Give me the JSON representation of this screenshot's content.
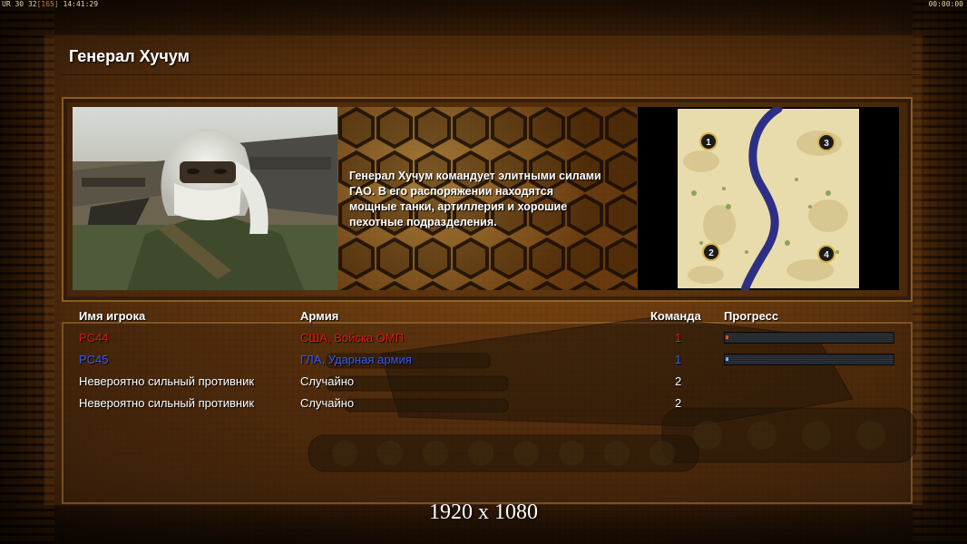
{
  "hud": {
    "left_a": "UR",
    "left_b": "30",
    "left_c": "32",
    "left_d": "[165]",
    "left_time": "14:41:29",
    "right_time": "00:00:00"
  },
  "title": "Генерал Хучум",
  "description": [
    "Генерал Хучум командует элитными силами",
    " ГАО. В его распоряжении находятся",
    " мощные танки, артиллерия и хорошие",
    " пехотные подразделения."
  ],
  "minimap": {
    "spawns": [
      "1",
      "2",
      "3",
      "4"
    ]
  },
  "table": {
    "headers": {
      "player": "Имя игрока",
      "army": "Армия",
      "team": "Команда",
      "progress": "Прогресс"
    },
    "rows": [
      {
        "player": "PC44",
        "army": "США, Войска ОМП",
        "team": "1",
        "color": "#e01a12",
        "progress": 0.0
      },
      {
        "player": "PC45",
        "army": "ГЛА, Ударная армия",
        "team": "1",
        "color": "#3a5cf0",
        "progress": 0.0
      },
      {
        "player": "Невероятно сильный противник",
        "army": "Случайно",
        "team": "2",
        "color": "#ffffff"
      },
      {
        "player": "Невероятно сильный противник",
        "army": "Случайно",
        "team": "2",
        "color": "#ffffff"
      }
    ]
  },
  "resolution_label": "1920 x 1080"
}
